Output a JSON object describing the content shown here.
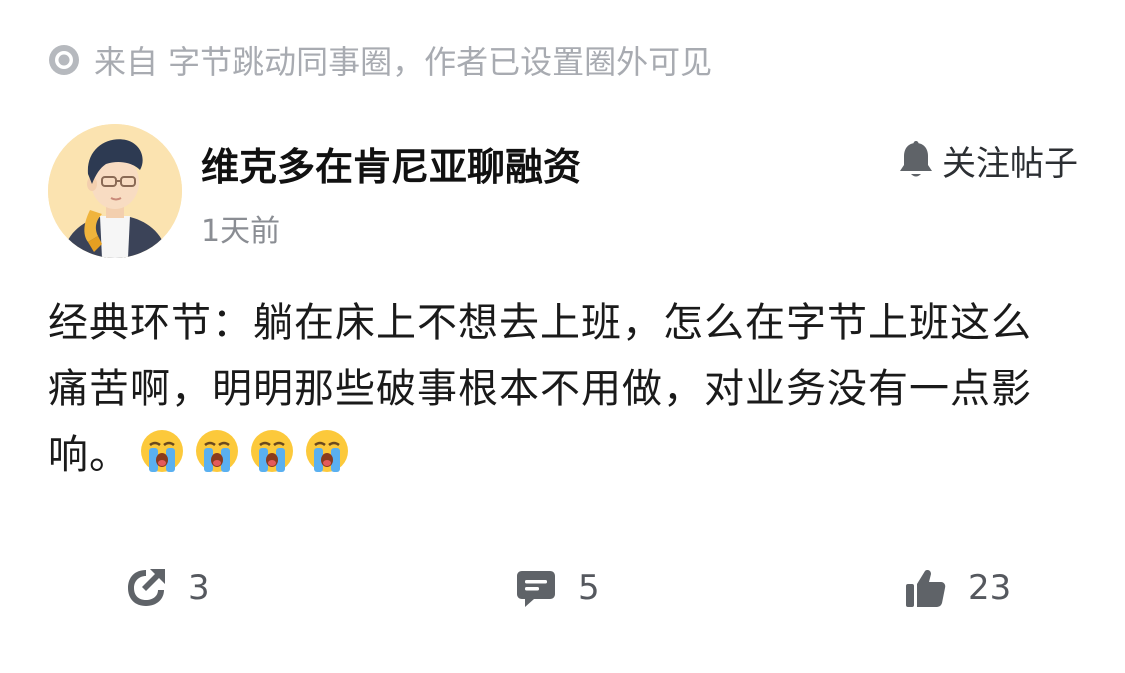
{
  "source": {
    "icon": "radio-dot-icon",
    "text": "来自 字节跳动同事圈，作者已设置圈外可见"
  },
  "author": {
    "name": "维克多在肯尼亚聊融资",
    "time": "1天前",
    "avatar_icon": "illustrated-avatar"
  },
  "follow": {
    "icon": "bell-icon",
    "label": "关注帖子"
  },
  "post": {
    "text": "经典环节：躺在床上不想去上班，怎么在字节上班这么痛苦啊，明明那些破事根本不用做，对业务没有一点影响。",
    "emojis": [
      "crying-face-emoji",
      "crying-face-emoji",
      "crying-face-emoji",
      "crying-face-emoji"
    ]
  },
  "actions": {
    "share": {
      "icon": "share-icon",
      "count": "3"
    },
    "comment": {
      "icon": "comment-icon",
      "count": "5"
    },
    "like": {
      "icon": "thumbs-up-icon",
      "count": "23"
    }
  },
  "colors": {
    "muted_text": "#a8abb1",
    "icon_gray": "#5f6368",
    "avatar_bg": "#fbe3b0"
  }
}
